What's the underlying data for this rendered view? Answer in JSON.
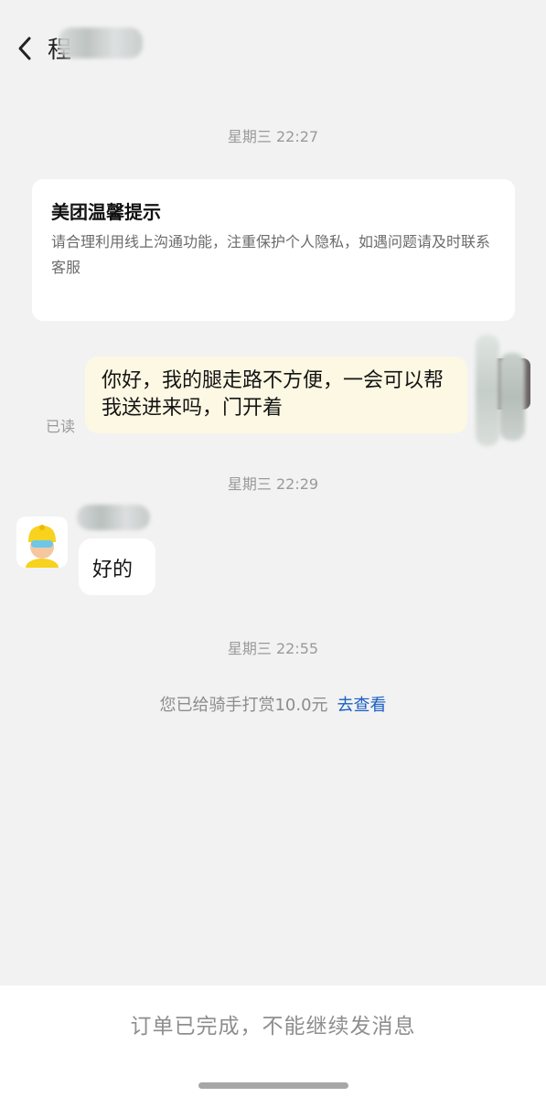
{
  "header": {
    "back_icon": "chevron-left-icon",
    "contact_name": "程"
  },
  "messages": {
    "time_1": "星期三 22:27",
    "notice": {
      "title": "美团温馨提示",
      "body": "请合理利用线上沟通功能，注重保护个人隐私，如遇问题请及时联系客服"
    },
    "my_message": {
      "text": "你好，我的腿走路不方便，一会可以帮我送进来吗，门开着",
      "status": "已读"
    },
    "time_2": "星期三 22:29",
    "rider_message": {
      "text": "好的"
    },
    "time_3": "星期三 22:55",
    "reward": {
      "text": "您已给骑手打赏10.0元",
      "link": "去查看",
      "link_color": "#1a5fc2"
    }
  },
  "footer": {
    "status_text": "订单已完成，不能继续发消息"
  },
  "colors": {
    "background": "#f2f2f2",
    "my_bubble": "#fcf8e3",
    "rider_avatar_helmet": "#f7d21f"
  }
}
